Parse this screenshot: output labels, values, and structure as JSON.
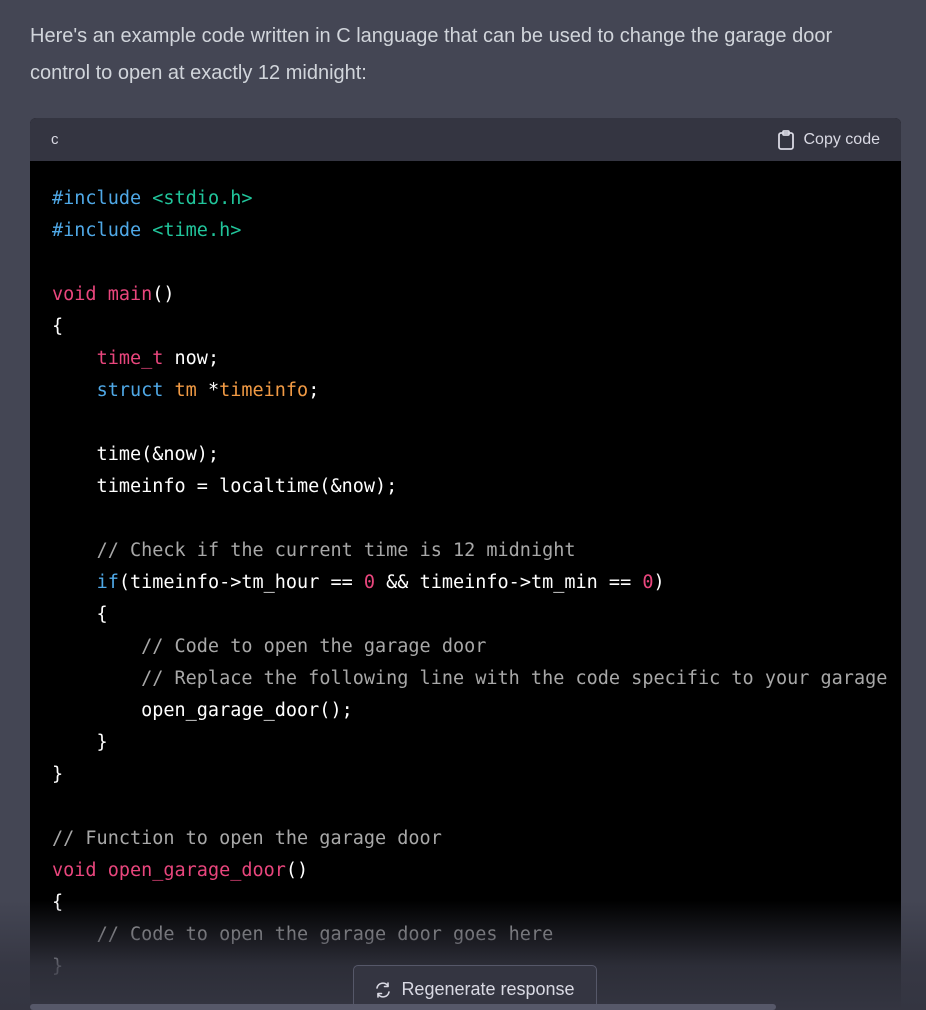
{
  "message": {
    "intro": "Here's an example code written in C language that can be used to change the garage door control to open at exactly 12 midnight:"
  },
  "code_block": {
    "language": "c",
    "copy_label": "Copy code",
    "lines": [
      [
        [
          "tok-pre",
          "#include "
        ],
        [
          "tok-str",
          "<stdio.h>"
        ]
      ],
      [
        [
          "tok-pre",
          "#include "
        ],
        [
          "tok-str",
          "<time.h>"
        ]
      ],
      [],
      [
        [
          "tok-kw",
          "void"
        ],
        [
          "",
          " "
        ],
        [
          "tok-kw",
          "main"
        ],
        [
          "",
          "()"
        ]
      ],
      [
        [
          "",
          "{"
        ]
      ],
      [
        [
          "",
          "    "
        ],
        [
          "tok-kw",
          "time_t"
        ],
        [
          "",
          " now;"
        ]
      ],
      [
        [
          "",
          "    "
        ],
        [
          "tok-kw2",
          "struct"
        ],
        [
          "",
          " "
        ],
        [
          "tok-var",
          "tm"
        ],
        [
          "",
          " *"
        ],
        [
          "tok-var",
          "timeinfo"
        ],
        [
          "",
          ";"
        ]
      ],
      [],
      [
        [
          "",
          "    time(&now);"
        ]
      ],
      [
        [
          "",
          "    timeinfo = localtime(&now);"
        ]
      ],
      [],
      [
        [
          "",
          "    "
        ],
        [
          "tok-com",
          "// Check if the current time is 12 midnight"
        ]
      ],
      [
        [
          "",
          "    "
        ],
        [
          "tok-kw2",
          "if"
        ],
        [
          "",
          "(timeinfo->tm_hour == "
        ],
        [
          "tok-num",
          "0"
        ],
        [
          "",
          " && timeinfo->tm_min == "
        ],
        [
          "tok-num",
          "0"
        ],
        [
          "",
          ")"
        ]
      ],
      [
        [
          "",
          "    {"
        ]
      ],
      [
        [
          "",
          "        "
        ],
        [
          "tok-com",
          "// Code to open the garage door"
        ]
      ],
      [
        [
          "",
          "        "
        ],
        [
          "tok-com",
          "// Replace the following line with the code specific to your garage"
        ]
      ],
      [
        [
          "",
          "        open_garage_door();"
        ]
      ],
      [
        [
          "",
          "    }"
        ]
      ],
      [
        [
          "",
          "}"
        ]
      ],
      [],
      [
        [
          "tok-com",
          "// Function to open the garage door"
        ]
      ],
      [
        [
          "tok-kw",
          "void"
        ],
        [
          "",
          " "
        ],
        [
          "tok-kw",
          "open_garage_door"
        ],
        [
          "",
          "()"
        ]
      ],
      [
        [
          "",
          "{"
        ]
      ],
      [
        [
          "",
          "    "
        ],
        [
          "tok-com",
          "// Code to open the garage door goes here"
        ]
      ],
      [
        [
          "",
          "}"
        ]
      ]
    ]
  },
  "regenerate_label": "Regenerate response",
  "icons": {
    "copy": "clipboard-icon",
    "regenerate": "refresh-icon"
  },
  "colors": {
    "background": "#444654",
    "code_bg": "#000000",
    "header_bg": "#343541",
    "keyword": "#e9467d",
    "preprocessor": "#4fa8e6",
    "string": "#21c59b",
    "type": "#f19a44",
    "comment": "#a8a8a8"
  }
}
